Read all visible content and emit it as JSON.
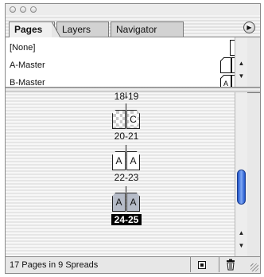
{
  "titlebar": {
    "buttons": [
      "close",
      "minimize",
      "zoom"
    ]
  },
  "tabs": [
    {
      "label": "Pages",
      "active": true
    },
    {
      "label": "Layers",
      "active": false
    },
    {
      "label": "Navigator",
      "active": false
    }
  ],
  "masters": [
    {
      "label": "[None]",
      "icon": "single-page-icon"
    },
    {
      "label": "A-Master",
      "icon": "spread-icon"
    },
    {
      "label": "B-Master",
      "icon": "spread-icon",
      "page_letters": [
        "A",
        "A"
      ]
    }
  ],
  "spreads": [
    {
      "label": "18-19",
      "pages": []
    },
    {
      "label": "20-21",
      "pages": [
        "",
        "C"
      ],
      "fill": "checker"
    },
    {
      "label": "22-23",
      "pages": [
        "A",
        "A"
      ]
    },
    {
      "label": "24-25",
      "pages": [
        "A",
        "A"
      ],
      "selected": true
    }
  ],
  "status": {
    "text": "17 Pages in 9 Spreads"
  },
  "scrollbar": {
    "pages_position": 0.78
  },
  "colors": {
    "selection": "#000000",
    "selected_page": "#b6bcc8",
    "scroll_thumb": "#3a6fe0"
  }
}
